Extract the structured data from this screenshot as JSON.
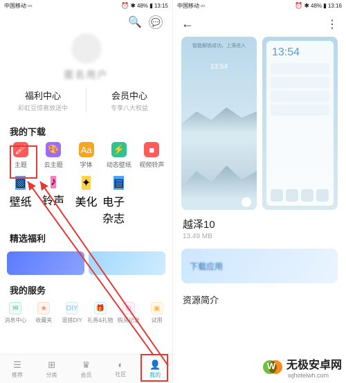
{
  "left": {
    "status": {
      "carrier": "中国移动",
      "signal_icons": "📶📶",
      "right_icons": "⏰ ✱ 48%",
      "battery": "48%",
      "time": "13:15"
    },
    "header": {
      "search_icon": "search-icon",
      "chat_icon": "chat-icon"
    },
    "profile": {
      "username": "匿名用户"
    },
    "centers": {
      "left_title": "福利中心",
      "left_sub": "彩虹豆惊喜放送中",
      "right_title": "会员中心",
      "right_sub": "专享八大权益"
    },
    "downloads": {
      "title": "我的下载",
      "row1": [
        {
          "icon": "brush",
          "color": "#ff5a5a",
          "label": "主题"
        },
        {
          "icon": "palette",
          "color": "#9c6bff",
          "label": "云主题"
        },
        {
          "icon": "Aa",
          "color": "#f5a623",
          "label": "字体"
        },
        {
          "icon": "flash",
          "color": "#33c18e",
          "label": "动态壁纸"
        },
        {
          "icon": "video",
          "color": "#ff5a5a",
          "label": "视频铃声"
        }
      ],
      "row2": [
        {
          "icon": "image",
          "color": "#4aa3ff",
          "label": "壁纸"
        },
        {
          "icon": "note",
          "color": "#ff7bbf",
          "label": "铃声"
        },
        {
          "icon": "sparkle",
          "color": "#ffd24a",
          "label": "美化"
        },
        {
          "icon": "book",
          "color": "#4aa3ff",
          "label": "电子杂志"
        }
      ]
    },
    "welfare": {
      "title": "精选福利",
      "banners": [
        {
          "color": "linear-gradient(120deg,#5b7bff,#8aa2ff)"
        },
        {
          "color": "linear-gradient(120deg,#a0d8ff,#d0ecff)"
        }
      ]
    },
    "services": {
      "title": "我的服务",
      "items": [
        {
          "label": "消息中心",
          "color": "#33c18e",
          "glyph": "✉"
        },
        {
          "label": "收藏夹",
          "color": "#ff8a4a",
          "glyph": "★"
        },
        {
          "label": "混搭DIY",
          "color": "#7bc3ff",
          "glyph": "DIY"
        },
        {
          "label": "礼券&礼物",
          "color": "#4ad8e6",
          "glyph": "🎁"
        },
        {
          "label": "购买记录",
          "color": "#ff7bbf",
          "glyph": "⊙"
        },
        {
          "label": "试用",
          "color": "#ffb64a",
          "glyph": "▣"
        }
      ]
    },
    "tabbar": [
      {
        "label": "推荐",
        "glyph": "☰"
      },
      {
        "label": "分类",
        "glyph": "⊞"
      },
      {
        "label": "会员",
        "glyph": "♛"
      },
      {
        "label": "社区",
        "glyph": "◐"
      },
      {
        "label": "我的",
        "glyph": "👤",
        "active": true
      }
    ]
  },
  "right": {
    "status": {
      "carrier": "中国移动",
      "battery": "48%",
      "time": "13:16"
    },
    "previews": {
      "clock": "13:54",
      "lock_text": "智能解锁成功，上滑进入"
    },
    "theme": {
      "name": "越泽10",
      "size": "13.49 MB"
    },
    "section": "资源简介",
    "banner_text": "下载应用"
  },
  "watermark": {
    "text": "无极安卓网",
    "domain": "wjhotelwh.com"
  }
}
